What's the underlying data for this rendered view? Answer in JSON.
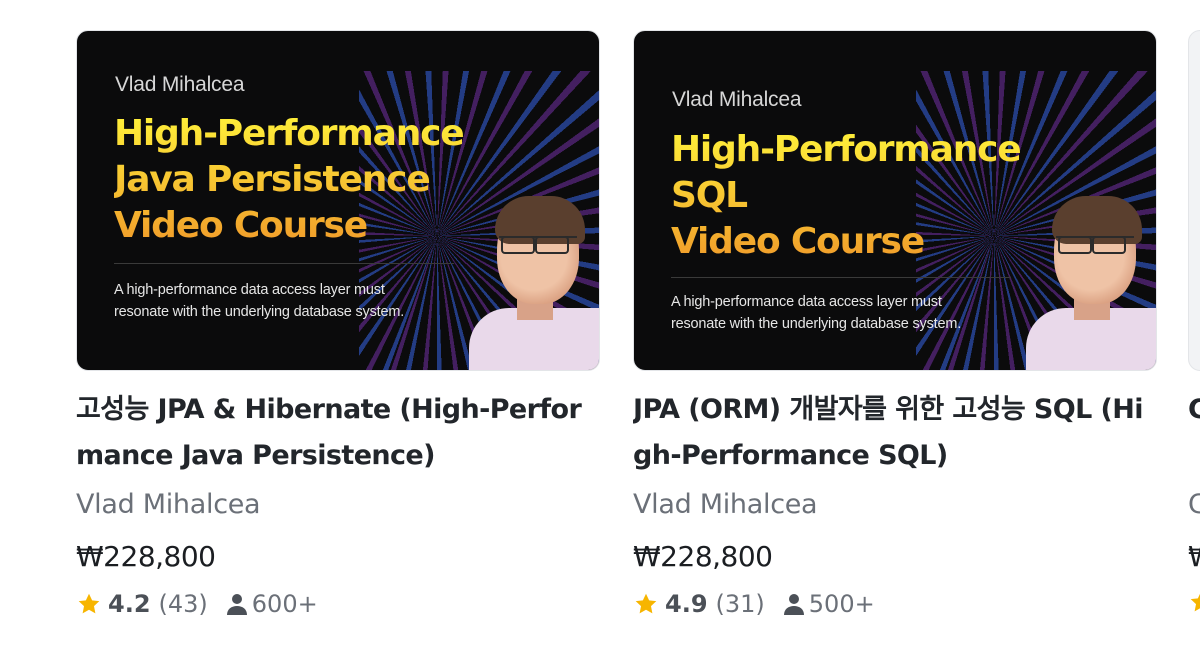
{
  "colors": {
    "title_gradient_top": "#fff23a",
    "title_gradient_bottom": "#f09a2a",
    "star": "#f7b500",
    "text_primary": "#22262b",
    "text_secondary": "#6b7078"
  },
  "cards": [
    {
      "thumbnail": {
        "author": "Vlad Mihalcea",
        "course_title": "High-Performance\nJava Persistence\nVideo Course",
        "tagline": "A high-performance data access layer must\nresonate with the underlying database system."
      },
      "title": "고성능 JPA & Hibernate (High-Performance Java Persistence)",
      "instructor": "Vlad Mihalcea",
      "price": "₩228,800",
      "rating": "4.2",
      "reviews": "(43)",
      "students": "600+",
      "icons": {
        "rating": "star-icon",
        "students": "user-icon"
      }
    },
    {
      "thumbnail": {
        "author": "Vlad Mihalcea",
        "course_title": "High-Performance\nSQL\nVideo Course",
        "tagline": "A high-performance data access layer must\nresonate with the underlying database system."
      },
      "title": "JPA (ORM) 개발자를 위한 고성능 SQL (High-Performance SQL)",
      "instructor": "Vlad Mihalcea",
      "price": "₩228,800",
      "rating": "4.9",
      "reviews": "(31)",
      "students": "500+",
      "icons": {
        "rating": "star-icon",
        "students": "user-icon"
      }
    },
    {
      "title": "C",
      "instructor": "C",
      "price": "₩"
    }
  ]
}
